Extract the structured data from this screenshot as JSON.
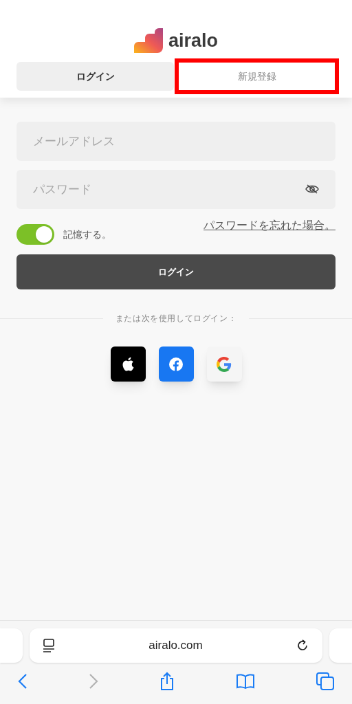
{
  "logo": {
    "text": "airalo"
  },
  "tabs": [
    {
      "label": "ログイン",
      "selected": true,
      "highlighted": false
    },
    {
      "label": "新規登録",
      "selected": false,
      "highlighted": true
    }
  ],
  "form": {
    "email": {
      "placeholder": "メールアドレス"
    },
    "password": {
      "placeholder": "パスワード"
    },
    "remember": {
      "label": "記憶する。",
      "on": true
    },
    "forgot_link": "パスワードを忘れた場合。",
    "submit": "ログイン"
  },
  "divider_text": "または次を使用してログイン：",
  "social": [
    {
      "kind": "apple"
    },
    {
      "kind": "facebook"
    },
    {
      "kind": "google"
    }
  ],
  "browser": {
    "url": "airalo.com",
    "back_disabled": false,
    "forward_disabled": true
  }
}
